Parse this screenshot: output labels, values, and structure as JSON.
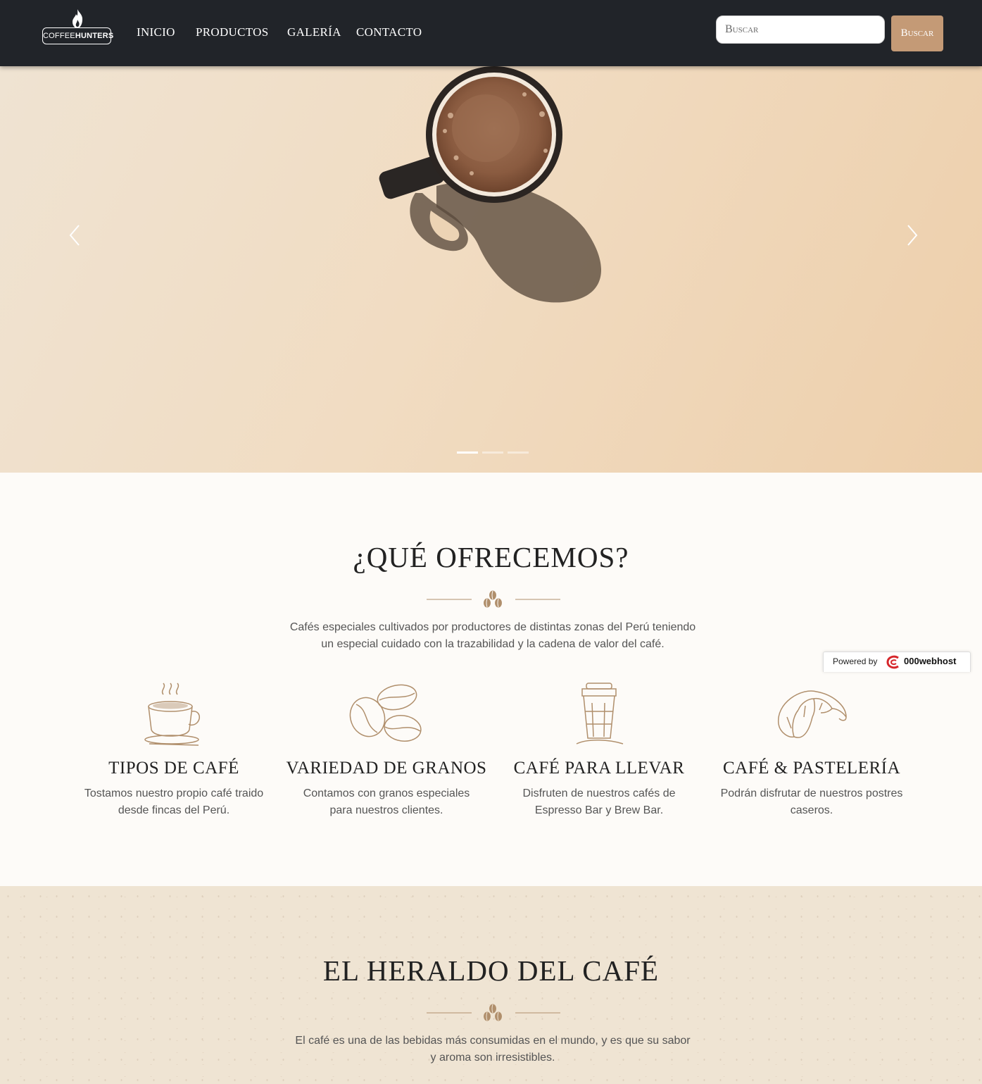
{
  "navbar": {
    "logo": {
      "text_light": "COFFEE",
      "text_bold": "HUNTERS"
    },
    "links": [
      {
        "label": "INICIO"
      },
      {
        "label": "PRODUCTOS"
      },
      {
        "label": "GALERÍA"
      },
      {
        "label": "CONTACTO"
      }
    ],
    "search": {
      "placeholder": "Buscar",
      "button_label": "Buscar"
    }
  },
  "hero": {
    "slides_count": 3,
    "active_slide": 1,
    "icons": {
      "prev": "chevron-left-icon",
      "next": "chevron-right-icon"
    }
  },
  "offer": {
    "title": "¿QUÉ OFRECEMOS?",
    "intro_line1": "Cafés especiales cultivados por productores de distintas zonas del Perú teniendo",
    "intro_line2": "un especial cuidado con la trazabilidad y la cadena de valor del café.",
    "features": [
      {
        "icon": "coffee-cup-icon",
        "title": "TIPOS DE CAFÉ",
        "line1": "Tostamos nuestro propio café traido",
        "line2": "desde fincas del Perú."
      },
      {
        "icon": "coffee-beans-icon",
        "title": "VARIEDAD DE GRANOS",
        "line1": "Contamos con granos especiales",
        "line2": "para nuestros clientes."
      },
      {
        "icon": "takeaway-cup-icon",
        "title": "CAFÉ PARA LLEVAR",
        "line1": "Disfruten de nuestros cafés de",
        "line2": "Espresso Bar y Brew Bar."
      },
      {
        "icon": "croissant-icon",
        "title": "CAFÉ & PASTELERÍA",
        "line1": "Podrán disfrutar de nuestros postres",
        "line2": "caseros."
      }
    ]
  },
  "powered": {
    "prefix": "Powered by",
    "brand": "000webhost"
  },
  "heraldo": {
    "title": "EL HERALDO DEL CAFÉ",
    "intro_line1": "El café es una de las bebidas más consumidas en el mundo, y es que su sabor",
    "intro_line2": "y aroma son irresistibles."
  },
  "colors": {
    "navbar_bg": "#212429",
    "accent": "#c49a76",
    "icon_stroke": "#b08f6c",
    "text_dark": "#222222",
    "text_body": "#555555"
  }
}
